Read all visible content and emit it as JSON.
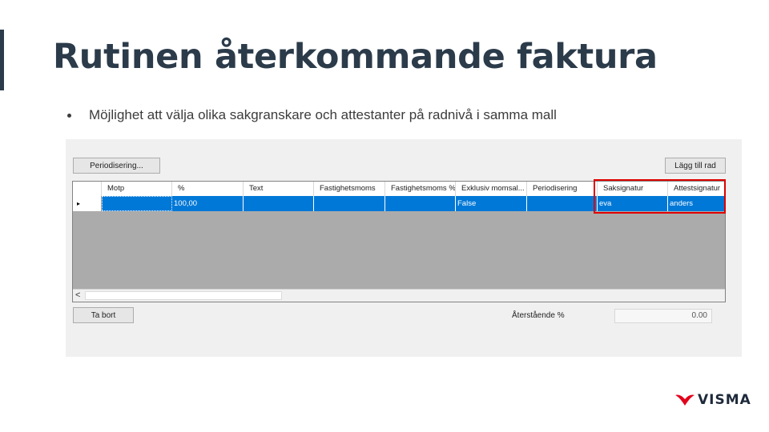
{
  "slide": {
    "title": "Rutinen återkommande faktura",
    "bullet": "Möjlighet att välja olika sakgranskare och attestanter på radnivå i samma mall"
  },
  "app": {
    "period_button": "Periodisering...",
    "add_row_button": "Lägg till rad",
    "delete_button": "Ta bort",
    "remaining_label": "Återstående %",
    "remaining_value": "0.00",
    "scroll_left": "<",
    "row_indicator": "▸",
    "columns": [
      "Motp",
      "%",
      "Text",
      "Fastighetsmoms",
      "Fastighetsmoms %",
      "Exklusiv momsal...",
      "Periodisering",
      "Saksignatur",
      "Attestsignatur"
    ],
    "row": [
      "",
      "100,00",
      "",
      "",
      "",
      "False",
      "",
      "eva",
      "anders"
    ]
  },
  "logo": {
    "text": "VISMA"
  },
  "colors": {
    "title": "#2b3b4a",
    "selection": "#0078d7",
    "highlight": "#e00000",
    "logo_red": "#e3001b"
  }
}
